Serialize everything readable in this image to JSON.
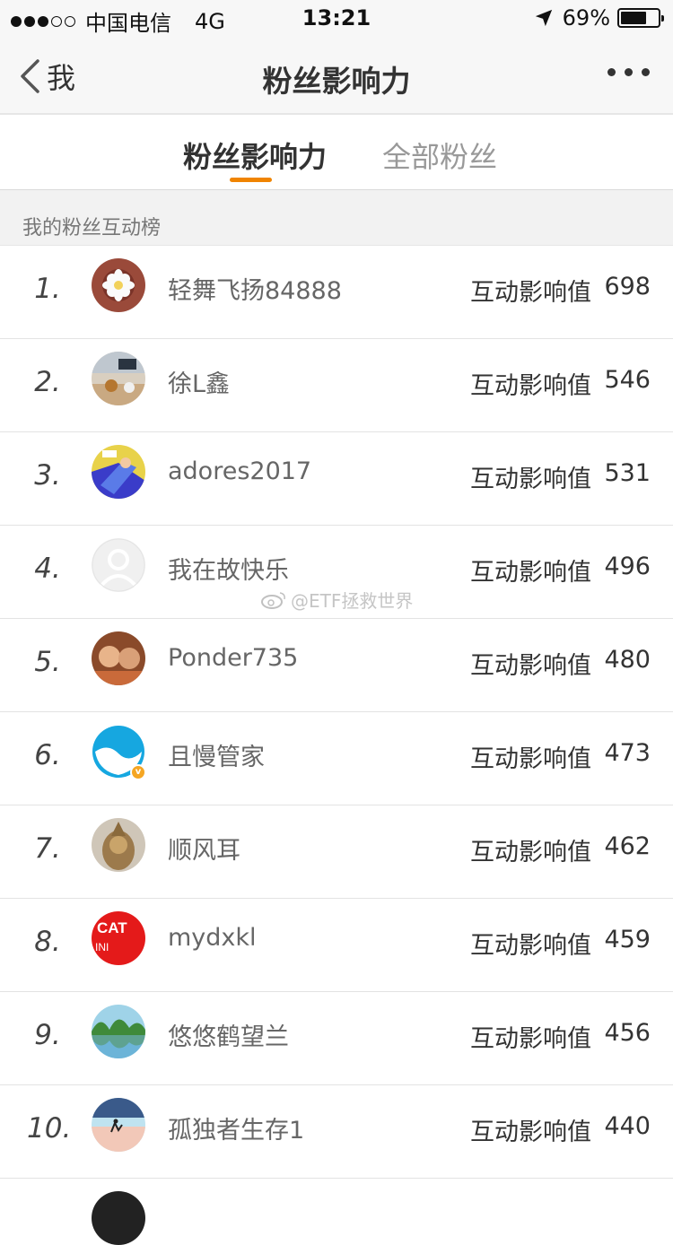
{
  "status_bar": {
    "carrier": "中国电信",
    "network": "4G",
    "time": "13:21",
    "battery": "69%",
    "battery_level": 0.69
  },
  "nav": {
    "back_label": "我",
    "title": "粉丝影响力"
  },
  "tabs": [
    {
      "label": "粉丝影响力",
      "active": true
    },
    {
      "label": "全部粉丝",
      "active": false
    }
  ],
  "section_title": "我的粉丝互动榜",
  "score_label": "互动影响值",
  "fans": [
    {
      "rank": "1.",
      "name": "轻舞飞扬84888",
      "score": "698"
    },
    {
      "rank": "2.",
      "name": "徐L鑫",
      "score": "546"
    },
    {
      "rank": "3.",
      "name": "adores2017",
      "score": "531"
    },
    {
      "rank": "4.",
      "name": "我在故快乐",
      "score": "496"
    },
    {
      "rank": "5.",
      "name": "Ponder735",
      "score": "480"
    },
    {
      "rank": "6.",
      "name": "且慢管家",
      "score": "473"
    },
    {
      "rank": "7.",
      "name": "顺风耳",
      "score": "462"
    },
    {
      "rank": "8.",
      "name": "mydxkl",
      "score": "459"
    },
    {
      "rank": "9.",
      "name": "悠悠鹤望兰",
      "score": "456"
    },
    {
      "rank": "10.",
      "name": "孤独者生存1",
      "score": "440"
    }
  ],
  "avatar_8_text_1": "CAT",
  "avatar_8_text_2": "INI",
  "watermark": "@ETF拯救世界",
  "colors": {
    "accent": "#f08400",
    "verified_badge": "#f5a623"
  }
}
